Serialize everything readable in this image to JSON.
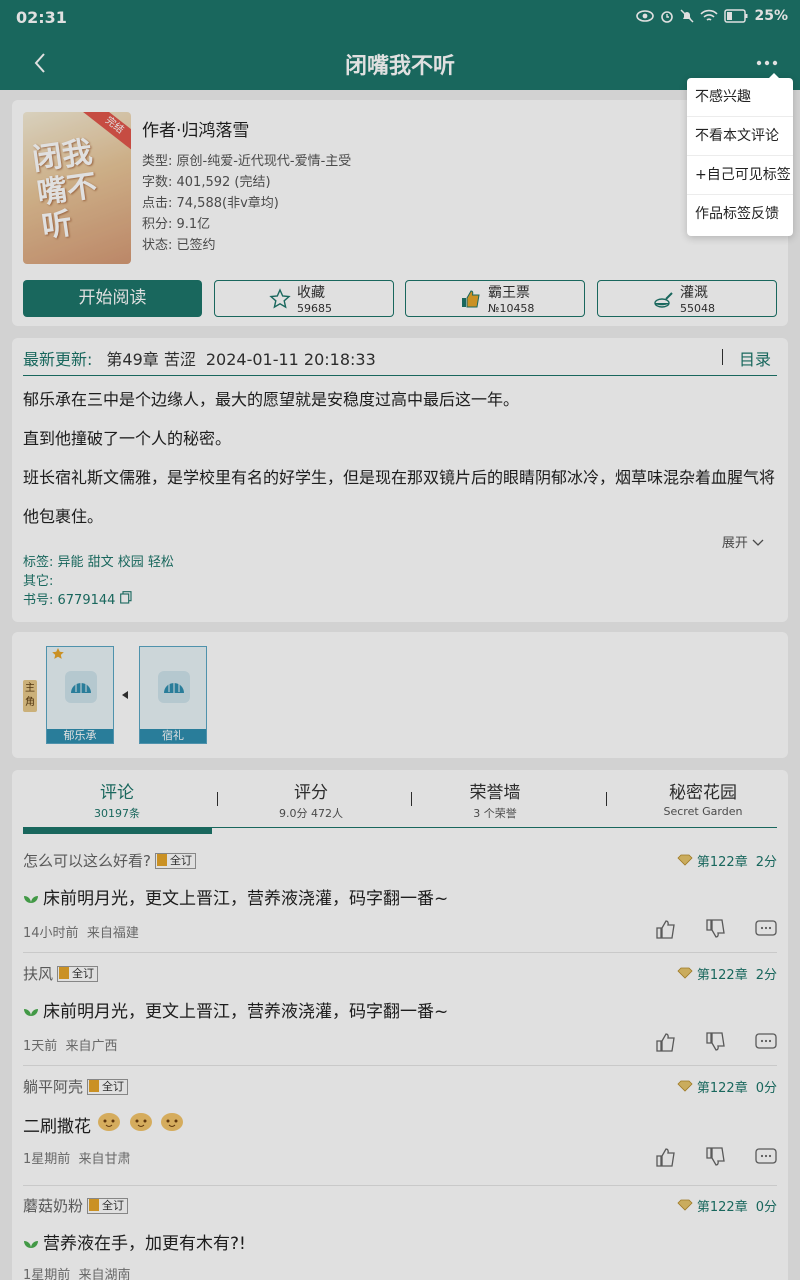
{
  "status_bar": {
    "time": "02:31",
    "battery": "25%"
  },
  "app_bar": {
    "title": "闭嘴我不听"
  },
  "book": {
    "cover_ribbon": "完结",
    "cover_title": "闭我嘴不听",
    "author": "作者·归鸿落雪",
    "type": "类型: 原创-纯爱-近代现代-爱情-主受",
    "words": "字数: 401,592 (完结)",
    "clicks": "点击: 74,588(非v章均)",
    "points": "积分: 9.1亿",
    "status": "状态: 已签约"
  },
  "actions": {
    "read": "开始阅读",
    "favorite": {
      "label": "收藏",
      "count": "59685"
    },
    "vote": {
      "label": "霸王票",
      "count": "№10458"
    },
    "water": {
      "label": "灌溉",
      "count": "55048"
    }
  },
  "update": {
    "label": "最新更新:",
    "chapter": "第49章  苦涩",
    "time": "2024-01-11 20:18:33",
    "toc": "目录"
  },
  "synopsis": {
    "p1": "郁乐承在三中是个边缘人，最大的愿望就是安稳度过高中最后这一年。",
    "p2": "直到他撞破了一个人的秘密。",
    "p3": "班长宿礼斯文儒雅，是学校里有名的好学生，但是现在那双镜片后的眼睛阴郁冰冷，烟草味混杂着血腥气将他包裹住。",
    "expand": "展开"
  },
  "tags": {
    "tag_line": "标签: 异能 甜文 校园 轻松",
    "other": "其它:",
    "book_id": "书号: 6779144"
  },
  "roles": {
    "tag": "主角",
    "char1": "郁乐承",
    "char2": "宿礼"
  },
  "tabs": [
    {
      "label": "评论",
      "sub": "30197条"
    },
    {
      "label": "评分",
      "sub": "9.0分 472人"
    },
    {
      "label": "荣誉墙",
      "sub": "3 个荣誉"
    },
    {
      "label": "秘密花园",
      "sub": "Secret Garden"
    }
  ],
  "badge_label": "全订",
  "comments": [
    {
      "user": "怎么可以这么好看?",
      "chapter": "第122章",
      "score": "2分",
      "body": "床前明月光，更文上晋江，营养液浇灌，码字翻一番~",
      "time": "14小时前",
      "loc": "来自福建"
    },
    {
      "user": "扶风",
      "chapter": "第122章",
      "score": "2分",
      "body": "床前明月光，更文上晋江，营养液浇灌，码字翻一番~",
      "time": "1天前",
      "loc": "来自广西"
    },
    {
      "user": "躺平阿壳",
      "chapter": "第122章",
      "score": "0分",
      "body": "二刷撒花",
      "time": "1星期前",
      "loc": "来自甘肃"
    },
    {
      "user": "蘑菇奶粉",
      "chapter": "第122章",
      "score": "0分",
      "body": "营养液在手，加更有木有?!",
      "time": "1星期前",
      "loc": "来自湖南"
    }
  ],
  "menu": [
    "不感兴趣",
    "不看本文评论",
    "+自己可见标签",
    "作品标签反馈"
  ]
}
